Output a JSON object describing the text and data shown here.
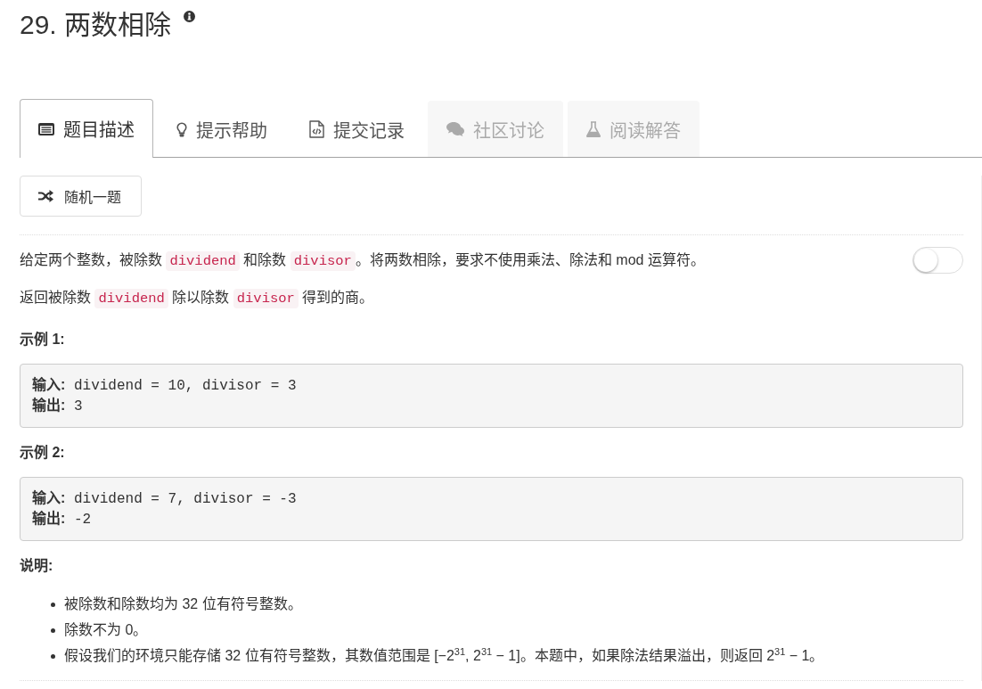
{
  "title": "29. 两数相除",
  "tabs": [
    {
      "label": "题目描述",
      "selected": true,
      "disabled": false
    },
    {
      "label": "提示帮助",
      "selected": false,
      "disabled": false
    },
    {
      "label": "提交记录",
      "selected": false,
      "disabled": false
    },
    {
      "label": "社区讨论",
      "selected": false,
      "disabled": true
    },
    {
      "label": "阅读解答",
      "selected": false,
      "disabled": true
    }
  ],
  "random_button": {
    "label": "随机一题"
  },
  "toggle": {
    "on": false
  },
  "description": {
    "paragraphs": [
      {
        "segments": [
          {
            "kind": "text",
            "text": "给定两个整数，被除数 "
          },
          {
            "kind": "code",
            "text": "dividend"
          },
          {
            "kind": "text",
            "text": " 和除数 "
          },
          {
            "kind": "code",
            "text": "divisor"
          },
          {
            "kind": "text",
            "text": "。将两数相除，要求不使用乘法、除法和 mod 运算符。"
          }
        ]
      },
      {
        "segments": [
          {
            "kind": "text",
            "text": "返回被除数 "
          },
          {
            "kind": "code",
            "text": "dividend"
          },
          {
            "kind": "text",
            "text": " 除以除数 "
          },
          {
            "kind": "code",
            "text": "divisor"
          },
          {
            "kind": "text",
            "text": " 得到的商。"
          }
        ]
      }
    ]
  },
  "examples": [
    {
      "heading": "示例 1:",
      "lines": [
        "**输入:** dividend = 10, divisor = 3",
        "**输出:** 3"
      ]
    },
    {
      "heading": "示例 2:",
      "lines": [
        "**输入:** dividend = 7, divisor = -3",
        "**输出:** -2"
      ]
    }
  ],
  "notes": {
    "heading": "说明:",
    "items": [
      "被除数和除数均为 32 位有符号整数。",
      "除数不为 0。",
      "假设我们的环境只能存储 32 位有符号整数，其数值范围是 [−2$^{31}$,  2$^{31}$ − 1]。本题中，如果除法结果溢出，则返回 2$^{31}$ − 1。"
    ]
  }
}
